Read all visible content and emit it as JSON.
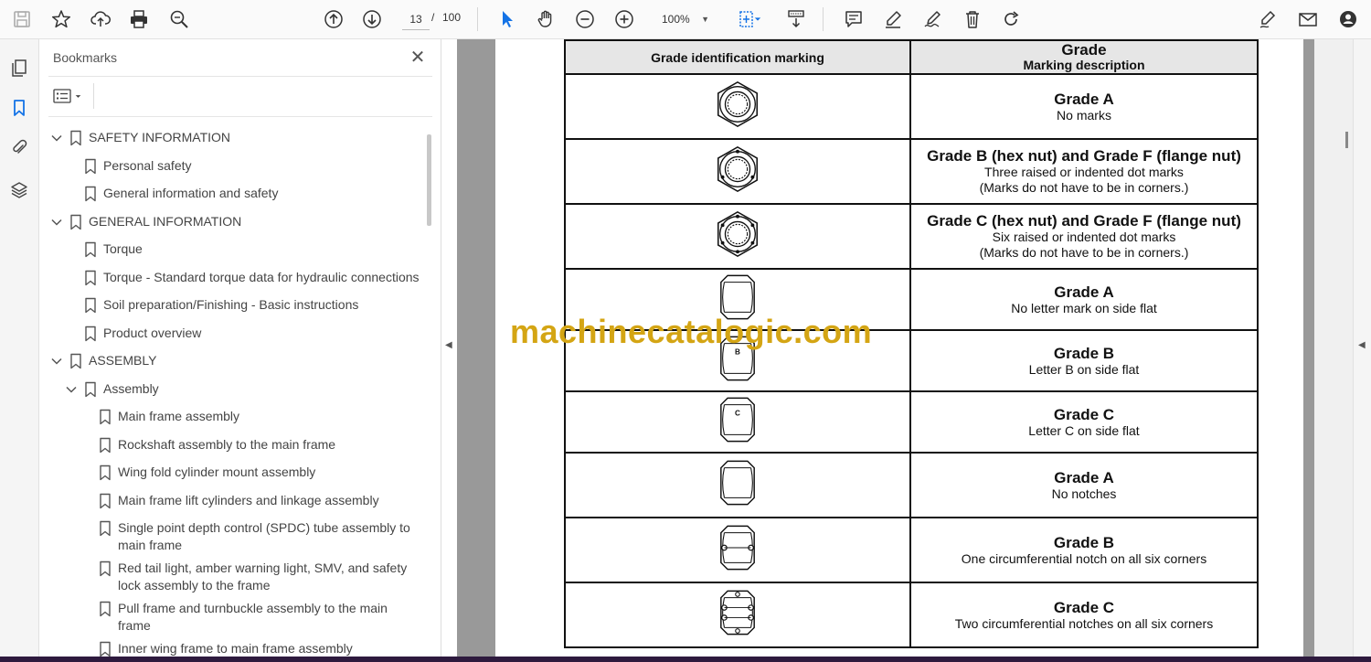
{
  "toolbar": {
    "current_page": "13",
    "page_separator": "/",
    "total_pages": "100",
    "zoom": "100%"
  },
  "bookmarks_panel": {
    "title": "Bookmarks",
    "close_symbol": "✕",
    "items": [
      {
        "label": "SAFETY INFORMATION",
        "level": 0,
        "expanded": true
      },
      {
        "label": "Personal safety",
        "level": 1
      },
      {
        "label": "General information and safety",
        "level": 1
      },
      {
        "label": "GENERAL INFORMATION",
        "level": 0,
        "expanded": true
      },
      {
        "label": "Torque",
        "level": 1
      },
      {
        "label": "Torque - Standard torque data for hydraulic connections",
        "level": 1
      },
      {
        "label": "Soil preparation/Finishing - Basic instructions",
        "level": 1
      },
      {
        "label": "Product overview",
        "level": 1
      },
      {
        "label": "ASSEMBLY",
        "level": 0,
        "expanded": true
      },
      {
        "label": "Assembly",
        "level": 1,
        "expanded": true
      },
      {
        "label": "Main frame assembly",
        "level": 2
      },
      {
        "label": "Rockshaft assembly to the main frame",
        "level": 2
      },
      {
        "label": "Wing fold cylinder mount assembly",
        "level": 2
      },
      {
        "label": "Main frame lift cylinders and linkage assembly",
        "level": 2
      },
      {
        "label_lines": [
          "Single point depth control (SPDC) tube assembly to",
          "main frame"
        ],
        "level": 2
      },
      {
        "label_lines": [
          "Red tail light, amber warning light, SMV, and safety",
          "lock assembly to the frame"
        ],
        "level": 2
      },
      {
        "label_lines": [
          "Pull frame and turnbuckle assembly to the main",
          "frame"
        ],
        "level": 2
      },
      {
        "label": "Inner wing frame to main frame assembly",
        "level": 2
      }
    ]
  },
  "document": {
    "table_header": {
      "col1": "Grade identification marking",
      "col2_top": "Grade",
      "col2_sub": "Marking description"
    },
    "rows": [
      {
        "symbol": "hex-nut-plain",
        "title": "Grade A",
        "lines": [
          "No marks"
        ]
      },
      {
        "symbol": "hex-nut-three-dots",
        "title": "Grade B (hex nut) and Grade F (flange nut)",
        "lines": [
          "Three raised or indented dot marks",
          "(Marks do not have to be in corners.)"
        ]
      },
      {
        "symbol": "hex-nut-six-dots",
        "title": "Grade C (hex nut) and Grade F (flange nut)",
        "lines": [
          "Six raised or indented dot marks",
          "(Marks do not have to be in corners.)"
        ]
      },
      {
        "symbol": "side-flat-plain",
        "title": "Grade A",
        "lines": [
          "No letter mark on side flat"
        ]
      },
      {
        "symbol": "side-flat-letter",
        "symbol_letter": "B",
        "title": "Grade B",
        "lines": [
          "Letter B on side flat"
        ]
      },
      {
        "symbol": "side-flat-letter",
        "symbol_letter": "C",
        "title": "Grade C",
        "lines": [
          "Letter C on side flat"
        ]
      },
      {
        "symbol": "side-no-notch",
        "title": "Grade A",
        "lines": [
          "No notches"
        ]
      },
      {
        "symbol": "side-one-notch",
        "title": "Grade B",
        "lines": [
          "One circumferential notch on all six corners"
        ]
      },
      {
        "symbol": "side-two-notch",
        "title": "Grade C",
        "lines": [
          "Two circumferential notches on all six corners"
        ]
      }
    ],
    "watermark": "machinecatalogic.com"
  },
  "colors": {
    "watermark": "#d4a514",
    "icon_blue": "#1473e6",
    "doc_background": "#999999"
  }
}
